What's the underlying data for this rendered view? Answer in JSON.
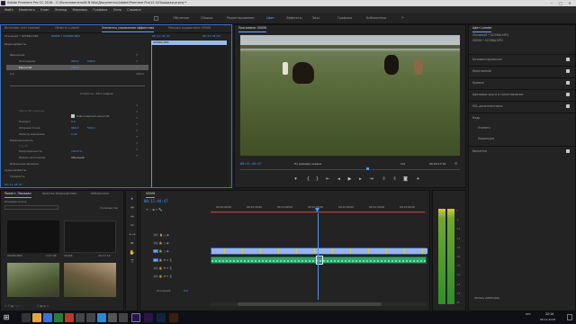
{
  "window": {
    "title": "Adobe Premiere Pro CC 2018 - C:\\Пользователи\\N N Nko\\Документы\\Adobe\\Premiere Pro\\12.0\\Лошадки.prproj *"
  },
  "menu": [
    "Файл",
    "Изменить",
    "Клип",
    "Эпизод",
    "Маркеры",
    "Графика",
    "Окно",
    "Справка"
  ],
  "workspaces": [
    {
      "label": "Обучение",
      "active": false
    },
    {
      "label": "Сборка",
      "active": false
    },
    {
      "label": "Редактирование",
      "active": false
    },
    {
      "label": "Цвет",
      "active": true
    },
    {
      "label": "Эффекты",
      "active": false
    },
    {
      "label": "Звук",
      "active": false
    },
    {
      "label": "Графика",
      "active": false
    },
    {
      "label": "Библиотеки",
      "active": false
    }
  ],
  "effect_controls": {
    "tabs": [
      "Источник: (нет клипов)",
      "Область Lumetri",
      "Элементы управления эффектами",
      "Микшер аудиоклипа: 00006"
    ],
    "active_tab": 2,
    "clip_header": "Основной * 02398A.MP4",
    "clip_link": "00006 * 02398A.MP4",
    "ruler_start": "00:11:44:47",
    "ruler_end": "00:11:45:04",
    "clip_bar": "02398A.MP4",
    "section_video": "Видеоэффекты",
    "motion": "Движение",
    "position_label": "Положение",
    "position_values": [
      "960,0",
      "540,0"
    ],
    "scale_label": "Масштаб",
    "scale_value": "100,0",
    "scale_range_min": "0,0",
    "scale_range_max": "100,0",
    "speed_label": "Скорость: -90,1 кадров",
    "scale_width_label": "Масштаб ширины",
    "uniform_scale": "Равномерный масштаб",
    "rotate_label": "Поворот",
    "rotate_value": "0,0",
    "anchor_label": "Опорная точка",
    "anchor_values": [
      "960,0",
      "540,0"
    ],
    "flicker_label": "Фильтр мерцания",
    "flicker_value": "0,00",
    "opacity_section": "Непрозрачность",
    "opacity_label": "Непрозрачность",
    "opacity_value": "100,0 %",
    "blend_label": "Режим наложения",
    "blend_value": "Обычный",
    "time_remap": "Изменение времени",
    "audio_section": "Аудиоэффекты",
    "volume": "Громкость",
    "footer_time": "00:11:44:47"
  },
  "program": {
    "title": "Программа: 00006",
    "timecode": "00:11:44:47",
    "fit": "По размеру экрана",
    "quality": "1/4",
    "duration": "00:20:17:19"
  },
  "lumetri": {
    "title": "Цвет Lumetri",
    "clip_header": "Основной * 02398A.MP4",
    "clip_link": "00006 * 02398A.MP4",
    "sections": [
      {
        "label": "Базовая коррекция",
        "checked": true
      },
      {
        "label": "Креативный",
        "checked": true
      },
      {
        "label": "Кривые",
        "checked": true
      },
      {
        "label": "Цветовые круги и сопоставление",
        "checked": true
      },
      {
        "label": "HSL-дополнительно",
        "checked": true
      },
      {
        "label": "Кадр",
        "checked": false
      },
      {
        "label": "Усилить",
        "checked": false
      },
      {
        "label": "Коррекция",
        "checked": false
      },
      {
        "label": "Виньетка",
        "checked": true
      }
    ]
  },
  "project": {
    "tabs": [
      "Проект: Лошадки",
      "Браузер медиаданных",
      "Библиотеки"
    ],
    "active_tab": 0,
    "file": "Лошадки.prproj",
    "count": "4 элементов",
    "items": [
      {
        "name": "00006.MP4",
        "duration": "1:07:08"
      },
      {
        "name": "00006",
        "duration": "20:17:19"
      },
      {
        "name": "02398A.MP4",
        "duration": ""
      },
      {
        "name": "02398A.MP4",
        "duration": ""
      }
    ]
  },
  "timeline": {
    "sequence": "00006",
    "timecode": "00:11:44:47",
    "ruler_labels": [
      "00:10:00:00",
      "00:10:30:00",
      "00:11:00:00",
      "00:11:30:00",
      "00:12:00:00",
      "00:12:30:00",
      "00:13:00:00"
    ],
    "tracks": [
      "V3",
      "V2",
      "V1",
      "A1",
      "A2",
      "A3"
    ],
    "master": "Основной",
    "master_value": "0,0"
  },
  "meter": {
    "db_labels": [
      "0",
      "-6",
      "-12",
      "-18",
      "-24",
      "-30",
      "-36",
      "-42",
      "-48",
      "-54",
      "dB"
    ]
  },
  "status": {
    "text": "Запись 2(8/01|00)",
    "time": "22:14",
    "date": "06.12.2018",
    "lang": "РУС"
  },
  "colors": {
    "accent": "#6aa6ff",
    "timecode": "#4c98ff",
    "video_clip": "#8ea9e3",
    "audio_clip": "#2ea36b",
    "playhead": "#4c98ff"
  }
}
